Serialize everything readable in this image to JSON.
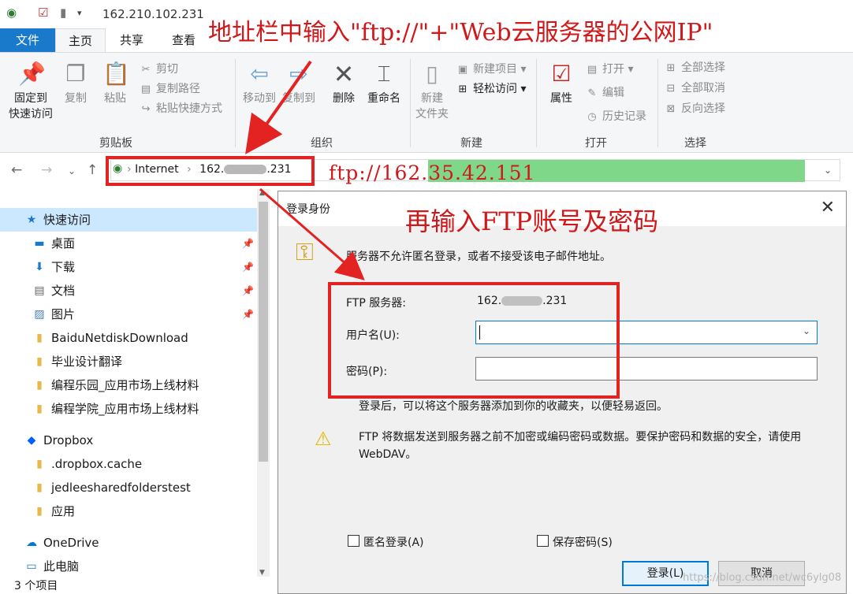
{
  "window": {
    "title": "162.210.102.231"
  },
  "ribbon": {
    "tabs": [
      {
        "label": "文件"
      },
      {
        "label": "主页"
      },
      {
        "label": "共享"
      },
      {
        "label": "查看"
      }
    ],
    "groups": {
      "clipboard": {
        "label": "剪贴板",
        "pin": "固定到",
        "pin2": "快速访问",
        "copy": "复制",
        "paste": "粘贴",
        "cut": "剪切",
        "copy_path": "复制路径",
        "paste_shortcut": "粘贴快捷方式"
      },
      "organize": {
        "label": "组织",
        "move_to": "移动到",
        "copy_to": "复制到",
        "delete": "删除",
        "rename": "重命名"
      },
      "new": {
        "label": "新建",
        "new_item": "新建项目",
        "easy_access": "轻松访问",
        "new_folder": "新建",
        "new_folder2": "文件夹"
      },
      "open": {
        "label": "打开",
        "properties": "属性",
        "open": "打开",
        "edit": "编辑",
        "history": "历史记录"
      },
      "select": {
        "label": "选择",
        "select_all": "全部选择",
        "select_none": "全部取消",
        "invert": "反向选择"
      }
    }
  },
  "address": {
    "crumb1": "Internet",
    "crumb2_start": "162.",
    "crumb2_end": ".231",
    "ftp_url": "ftp://162.35.42.151"
  },
  "nav": {
    "items": [
      {
        "label": "快速访问",
        "icon": "star-icon",
        "pinned": false
      },
      {
        "label": "桌面",
        "icon": "desktop-icon",
        "pinned": true
      },
      {
        "label": "下载",
        "icon": "download-icon",
        "pinned": true
      },
      {
        "label": "文档",
        "icon": "document-icon",
        "pinned": true
      },
      {
        "label": "图片",
        "icon": "picture-icon",
        "pinned": true
      },
      {
        "label": "BaiduNetdiskDownload",
        "icon": "folder-icon",
        "pinned": false
      },
      {
        "label": "毕业设计翻译",
        "icon": "folder-icon",
        "pinned": false
      },
      {
        "label": "编程乐园_应用市场上线材料",
        "icon": "folder-icon",
        "pinned": false
      },
      {
        "label": "编程学院_应用市场上线材料",
        "icon": "folder-icon",
        "pinned": false
      },
      {
        "label": "Dropbox",
        "icon": "dropbox-icon",
        "pinned": false
      },
      {
        "label": ".dropbox.cache",
        "icon": "folder-icon",
        "pinned": false
      },
      {
        "label": "jedleesharedfolderstest",
        "icon": "synced-folder-icon",
        "pinned": false
      },
      {
        "label": "应用",
        "icon": "synced-folder-icon",
        "pinned": false
      },
      {
        "label": "OneDrive",
        "icon": "cloud-icon",
        "pinned": false
      },
      {
        "label": "此电脑",
        "icon": "computer-icon",
        "pinned": false
      }
    ],
    "status": "3 个项目"
  },
  "dialog": {
    "title": "登录身份",
    "message": "服务器不允许匿名登录，或者不接受该电子邮件地址。",
    "server_label": "FTP 服务器:",
    "server_start": "162.",
    "server_end": ".231",
    "username_label": "用户名(U):",
    "username_value": "",
    "password_label": "密码(P):",
    "password_value": "",
    "hint": "登录后，可以将这个服务器添加到你的收藏夹，以便轻易返回。",
    "warning_line1": "FTP 将数据发送到服务器之前不加密或编码密码或数据。要保护密码和数据的安全，请使用",
    "warning_line2": "WebDAV。",
    "anonymous_label": "匿名登录(A)",
    "anonymous_checked": false,
    "save_password_label": "保存密码(S)",
    "save_password_checked": false,
    "login_button": "登录(L)",
    "cancel_button": "取消"
  },
  "annotations": {
    "top": "地址栏中输入\"ftp://\"+\"Web云服务器的公网IP\"",
    "dialog": "再输入FTP账号及密码"
  },
  "watermark": "https://blog.csdn.net/wc6ylg08",
  "colors": {
    "annotation_red": "#e32222",
    "accent_blue": "#1979ca",
    "highlight_green": "#7fd789"
  }
}
